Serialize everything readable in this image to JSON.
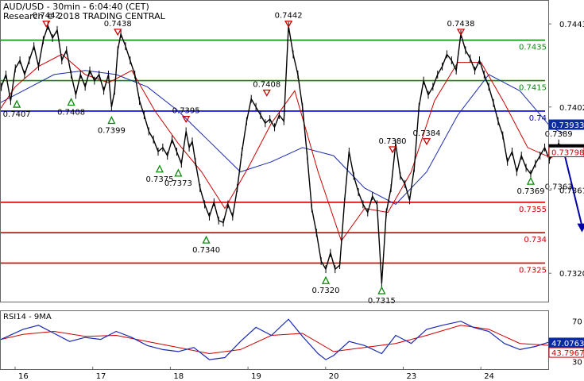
{
  "header": {
    "title": "AUD/USD - 30min - 6:04:40 (CET)",
    "research": "Research © 2018 TRADING CENTRAL"
  },
  "colors": {
    "price": "#000000",
    "support": "#cc0000",
    "resistance": "#0a8a0a",
    "pivot": "#0000cc",
    "ma_fast": "#cc0000",
    "ma_slow": "#1a2ab0",
    "rsi": "#1a2ab0",
    "rsi_ma": "#cc0000",
    "arrow": "#0000aa",
    "down_marker": "#cc0000",
    "up_marker": "#0a8a0a"
  },
  "chart_data": [
    {
      "type": "candlestick-line",
      "ylim": [
        0.7306,
        0.7454
      ],
      "y_ticks": [
        "0.7443",
        "0.7402",
        "0.7361",
        "0.7320"
      ],
      "x_ticks": [
        "16",
        "17",
        "18",
        "19",
        "20",
        "23",
        "24"
      ],
      "price": [
        [
          15.6,
          0.7388
        ],
        [
          15.66,
          0.74
        ],
        [
          15.72,
          0.7412
        ],
        [
          15.78,
          0.7418
        ],
        [
          15.84,
          0.7405
        ],
        [
          15.9,
          0.7421
        ],
        [
          15.96,
          0.7425
        ],
        [
          16.02,
          0.7418
        ],
        [
          16.08,
          0.7425
        ],
        [
          16.14,
          0.7432
        ],
        [
          16.2,
          0.7422
        ],
        [
          16.26,
          0.7435
        ],
        [
          16.32,
          0.7442
        ],
        [
          16.38,
          0.7436
        ],
        [
          16.44,
          0.744
        ],
        [
          16.5,
          0.7425
        ],
        [
          16.56,
          0.743
        ],
        [
          16.62,
          0.7418
        ],
        [
          16.68,
          0.7408
        ],
        [
          16.74,
          0.7418
        ],
        [
          16.8,
          0.7412
        ],
        [
          16.86,
          0.742
        ],
        [
          16.92,
          0.7415
        ],
        [
          16.98,
          0.7418
        ],
        [
          17.04,
          0.741
        ],
        [
          17.1,
          0.7418
        ],
        [
          17.14,
          0.7402
        ],
        [
          17.18,
          0.741
        ],
        [
          17.22,
          0.743
        ],
        [
          17.26,
          0.7438
        ],
        [
          17.32,
          0.7432
        ],
        [
          17.38,
          0.7425
        ],
        [
          17.44,
          0.7418
        ],
        [
          17.5,
          0.7405
        ],
        [
          17.56,
          0.7398
        ],
        [
          17.62,
          0.739
        ],
        [
          17.68,
          0.7386
        ],
        [
          17.74,
          0.738
        ],
        [
          17.8,
          0.7382
        ],
        [
          17.86,
          0.7378
        ],
        [
          17.92,
          0.7386
        ],
        [
          17.98,
          0.738
        ],
        [
          18.04,
          0.7374
        ],
        [
          18.1,
          0.739
        ],
        [
          18.14,
          0.7382
        ],
        [
          18.18,
          0.7385
        ],
        [
          18.22,
          0.7375
        ],
        [
          18.28,
          0.7362
        ],
        [
          18.34,
          0.7354
        ],
        [
          18.4,
          0.7348
        ],
        [
          18.46,
          0.7355
        ],
        [
          18.52,
          0.7346
        ],
        [
          18.58,
          0.7345
        ],
        [
          18.64,
          0.7354
        ],
        [
          18.7,
          0.7348
        ],
        [
          18.76,
          0.7362
        ],
        [
          18.82,
          0.738
        ],
        [
          18.88,
          0.7395
        ],
        [
          18.94,
          0.7406
        ],
        [
          19.0,
          0.7402
        ],
        [
          19.06,
          0.7398
        ],
        [
          19.12,
          0.7394
        ],
        [
          19.18,
          0.7396
        ],
        [
          19.24,
          0.7392
        ],
        [
          19.3,
          0.7398
        ],
        [
          19.36,
          0.7395
        ],
        [
          19.42,
          0.7442
        ],
        [
          19.48,
          0.7428
        ],
        [
          19.54,
          0.7418
        ],
        [
          19.6,
          0.7402
        ],
        [
          19.66,
          0.7378
        ],
        [
          19.72,
          0.7352
        ],
        [
          19.78,
          0.734
        ],
        [
          19.84,
          0.7326
        ],
        [
          19.9,
          0.7322
        ],
        [
          19.96,
          0.733
        ],
        [
          20.02,
          0.7322
        ],
        [
          20.08,
          0.7324
        ],
        [
          20.14,
          0.7355
        ],
        [
          20.2,
          0.738
        ],
        [
          20.26,
          0.7368
        ],
        [
          20.32,
          0.736
        ],
        [
          20.38,
          0.7354
        ],
        [
          20.44,
          0.735
        ],
        [
          20.5,
          0.7358
        ],
        [
          20.56,
          0.7354
        ],
        [
          20.62,
          0.7315
        ],
        [
          20.68,
          0.735
        ],
        [
          20.74,
          0.7362
        ],
        [
          20.8,
          0.7384
        ],
        [
          20.86,
          0.7368
        ],
        [
          20.92,
          0.7364
        ],
        [
          20.98,
          0.7356
        ],
        [
          21.04,
          0.7372
        ],
        [
          21.1,
          0.7402
        ],
        [
          21.16,
          0.7415
        ],
        [
          21.22,
          0.7408
        ],
        [
          21.28,
          0.7412
        ],
        [
          21.34,
          0.7418
        ],
        [
          21.4,
          0.7422
        ],
        [
          21.46,
          0.7428
        ],
        [
          21.52,
          0.7425
        ],
        [
          21.58,
          0.742
        ],
        [
          21.64,
          0.7438
        ],
        [
          21.7,
          0.743
        ],
        [
          21.76,
          0.7426
        ],
        [
          21.82,
          0.742
        ],
        [
          21.88,
          0.7425
        ],
        [
          21.94,
          0.7418
        ],
        [
          22.0,
          0.7412
        ],
        [
          22.06,
          0.7404
        ],
        [
          22.12,
          0.7395
        ],
        [
          22.18,
          0.7388
        ],
        [
          22.24,
          0.7375
        ],
        [
          22.3,
          0.738
        ],
        [
          22.36,
          0.737
        ],
        [
          22.42,
          0.7378
        ],
        [
          22.48,
          0.7372
        ],
        [
          22.54,
          0.7369
        ],
        [
          22.6,
          0.7374
        ],
        [
          22.66,
          0.7378
        ],
        [
          22.72,
          0.7382
        ],
        [
          22.78,
          0.7376
        ],
        [
          22.84,
          0.738
        ],
        [
          22.9,
          0.7384
        ],
        [
          22.96,
          0.7381
        ]
      ],
      "ma_fast": [
        [
          15.6,
          0.7395
        ],
        [
          15.9,
          0.7412
        ],
        [
          16.2,
          0.7422
        ],
        [
          16.5,
          0.7428
        ],
        [
          16.8,
          0.7418
        ],
        [
          17.1,
          0.7414
        ],
        [
          17.4,
          0.742
        ],
        [
          17.7,
          0.74
        ],
        [
          18.0,
          0.7384
        ],
        [
          18.3,
          0.737
        ],
        [
          18.6,
          0.7352
        ],
        [
          18.9,
          0.7372
        ],
        [
          19.2,
          0.7394
        ],
        [
          19.5,
          0.741
        ],
        [
          19.8,
          0.737
        ],
        [
          20.1,
          0.7336
        ],
        [
          20.4,
          0.7352
        ],
        [
          20.7,
          0.735
        ],
        [
          21.0,
          0.737
        ],
        [
          21.3,
          0.7405
        ],
        [
          21.6,
          0.7424
        ],
        [
          21.9,
          0.7424
        ],
        [
          22.2,
          0.7404
        ],
        [
          22.5,
          0.7382
        ],
        [
          22.8,
          0.7377
        ],
        [
          22.96,
          0.738
        ]
      ],
      "ma_slow": [
        [
          15.6,
          0.7402
        ],
        [
          16.0,
          0.741
        ],
        [
          16.4,
          0.7418
        ],
        [
          16.8,
          0.742
        ],
        [
          17.2,
          0.7418
        ],
        [
          17.6,
          0.7412
        ],
        [
          18.0,
          0.74
        ],
        [
          18.4,
          0.7385
        ],
        [
          18.8,
          0.737
        ],
        [
          19.2,
          0.7375
        ],
        [
          19.6,
          0.7382
        ],
        [
          20.0,
          0.7378
        ],
        [
          20.4,
          0.7362
        ],
        [
          20.8,
          0.7354
        ],
        [
          21.2,
          0.737
        ],
        [
          21.6,
          0.7398
        ],
        [
          22.0,
          0.7418
        ],
        [
          22.4,
          0.741
        ],
        [
          22.8,
          0.7392
        ],
        [
          22.96,
          0.7389
        ]
      ],
      "levels": [
        {
          "kind": "resistance",
          "value": 0.7435,
          "label": "0.7435"
        },
        {
          "kind": "resistance",
          "value": 0.7415,
          "label": "0.7415"
        },
        {
          "kind": "pivot",
          "value": 0.74,
          "label": "0.74"
        },
        {
          "kind": "support",
          "value": 0.7355,
          "label": "0.7355"
        },
        {
          "kind": "support",
          "value": 0.734,
          "label": "0.734"
        },
        {
          "kind": "support",
          "value": 0.7325,
          "label": "0.7325"
        }
      ],
      "price_tags": [
        {
          "value": 0.73933,
          "label": "0.73933",
          "style": "blue"
        },
        {
          "value": 0.73811,
          "label": "0.73811",
          "style": "black"
        },
        {
          "value": 0.73798,
          "label": "0.73798",
          "style": "red"
        }
      ],
      "annotations": [
        {
          "x": 16.3,
          "y": 0.7442,
          "label": "0.7442",
          "dir": "down"
        },
        {
          "x": 17.22,
          "y": 0.7438,
          "label": "0.7438",
          "dir": "down"
        },
        {
          "x": 19.14,
          "y": 0.7408,
          "label": "0.7408",
          "dir": "down"
        },
        {
          "x": 19.42,
          "y": 0.7442,
          "label": "0.7442",
          "dir": "down"
        },
        {
          "x": 18.1,
          "y": 0.7395,
          "label": "0.7395",
          "dir": "down"
        },
        {
          "x": 20.76,
          "y": 0.738,
          "label": "0.7380",
          "dir": "down"
        },
        {
          "x": 21.2,
          "y": 0.7384,
          "label": "0.7384",
          "dir": "down"
        },
        {
          "x": 21.64,
          "y": 0.7438,
          "label": "0.7438",
          "dir": "down"
        },
        {
          "x": 22.9,
          "y": 0.7389,
          "label": "0.7389",
          "dir": "none"
        },
        {
          "x": 15.92,
          "y": 0.7407,
          "label": "0.7407",
          "dir": "up"
        },
        {
          "x": 16.62,
          "y": 0.7408,
          "label": "0.7408",
          "dir": "up"
        },
        {
          "x": 17.14,
          "y": 0.7399,
          "label": "0.7399",
          "dir": "up"
        },
        {
          "x": 17.76,
          "y": 0.7375,
          "label": "0.7375",
          "dir": "up"
        },
        {
          "x": 18.0,
          "y": 0.7373,
          "label": "0.7373",
          "dir": "up"
        },
        {
          "x": 18.36,
          "y": 0.734,
          "label": "0.7340",
          "dir": "up"
        },
        {
          "x": 19.9,
          "y": 0.732,
          "label": "0.7320",
          "dir": "up"
        },
        {
          "x": 20.62,
          "y": 0.7315,
          "label": "0.7315",
          "dir": "up"
        },
        {
          "x": 22.54,
          "y": 0.7369,
          "label": "0.7369",
          "dir": "up"
        },
        {
          "x": 22.9,
          "y": 0.7363,
          "label": "0.7363",
          "dir": "none"
        }
      ],
      "forecast": {
        "from": [
          22.96,
          0.7381
        ],
        "to": [
          23.2,
          0.7341
        ]
      }
    },
    {
      "type": "line",
      "title": "RSI14 - 9MA",
      "ylim": [
        25,
        80
      ],
      "y_ticks": [
        "70",
        "30"
      ],
      "rsi": [
        [
          15.6,
          48
        ],
        [
          15.8,
          55
        ],
        [
          16.0,
          62
        ],
        [
          16.2,
          66
        ],
        [
          16.4,
          58
        ],
        [
          16.6,
          50
        ],
        [
          16.8,
          54
        ],
        [
          17.0,
          52
        ],
        [
          17.2,
          60
        ],
        [
          17.4,
          54
        ],
        [
          17.6,
          46
        ],
        [
          17.8,
          42
        ],
        [
          18.0,
          40
        ],
        [
          18.2,
          44
        ],
        [
          18.4,
          32
        ],
        [
          18.6,
          34
        ],
        [
          18.8,
          50
        ],
        [
          19.0,
          64
        ],
        [
          19.2,
          56
        ],
        [
          19.42,
          72
        ],
        [
          19.6,
          55
        ],
        [
          19.8,
          38
        ],
        [
          19.9,
          32
        ],
        [
          20.0,
          36
        ],
        [
          20.2,
          50
        ],
        [
          20.4,
          46
        ],
        [
          20.62,
          38
        ],
        [
          20.8,
          56
        ],
        [
          21.0,
          48
        ],
        [
          21.2,
          62
        ],
        [
          21.4,
          66
        ],
        [
          21.64,
          70
        ],
        [
          21.8,
          64
        ],
        [
          22.0,
          60
        ],
        [
          22.2,
          48
        ],
        [
          22.4,
          42
        ],
        [
          22.6,
          45
        ],
        [
          22.8,
          50
        ],
        [
          22.96,
          47
        ]
      ],
      "rsi_ma": [
        [
          15.6,
          50
        ],
        [
          16.0,
          57
        ],
        [
          16.4,
          60
        ],
        [
          16.8,
          55
        ],
        [
          17.2,
          56
        ],
        [
          17.6,
          50
        ],
        [
          18.0,
          44
        ],
        [
          18.4,
          38
        ],
        [
          18.8,
          42
        ],
        [
          19.2,
          56
        ],
        [
          19.6,
          58
        ],
        [
          20.0,
          40
        ],
        [
          20.4,
          44
        ],
        [
          20.8,
          48
        ],
        [
          21.2,
          56
        ],
        [
          21.64,
          66
        ],
        [
          22.0,
          62
        ],
        [
          22.4,
          48
        ],
        [
          22.8,
          46
        ],
        [
          22.96,
          46
        ]
      ],
      "tags": [
        {
          "value": 47.0763,
          "label": "47.0763",
          "style": "blue"
        },
        {
          "value": 43.7967,
          "label": "43.7967",
          "style": "red"
        }
      ]
    }
  ]
}
